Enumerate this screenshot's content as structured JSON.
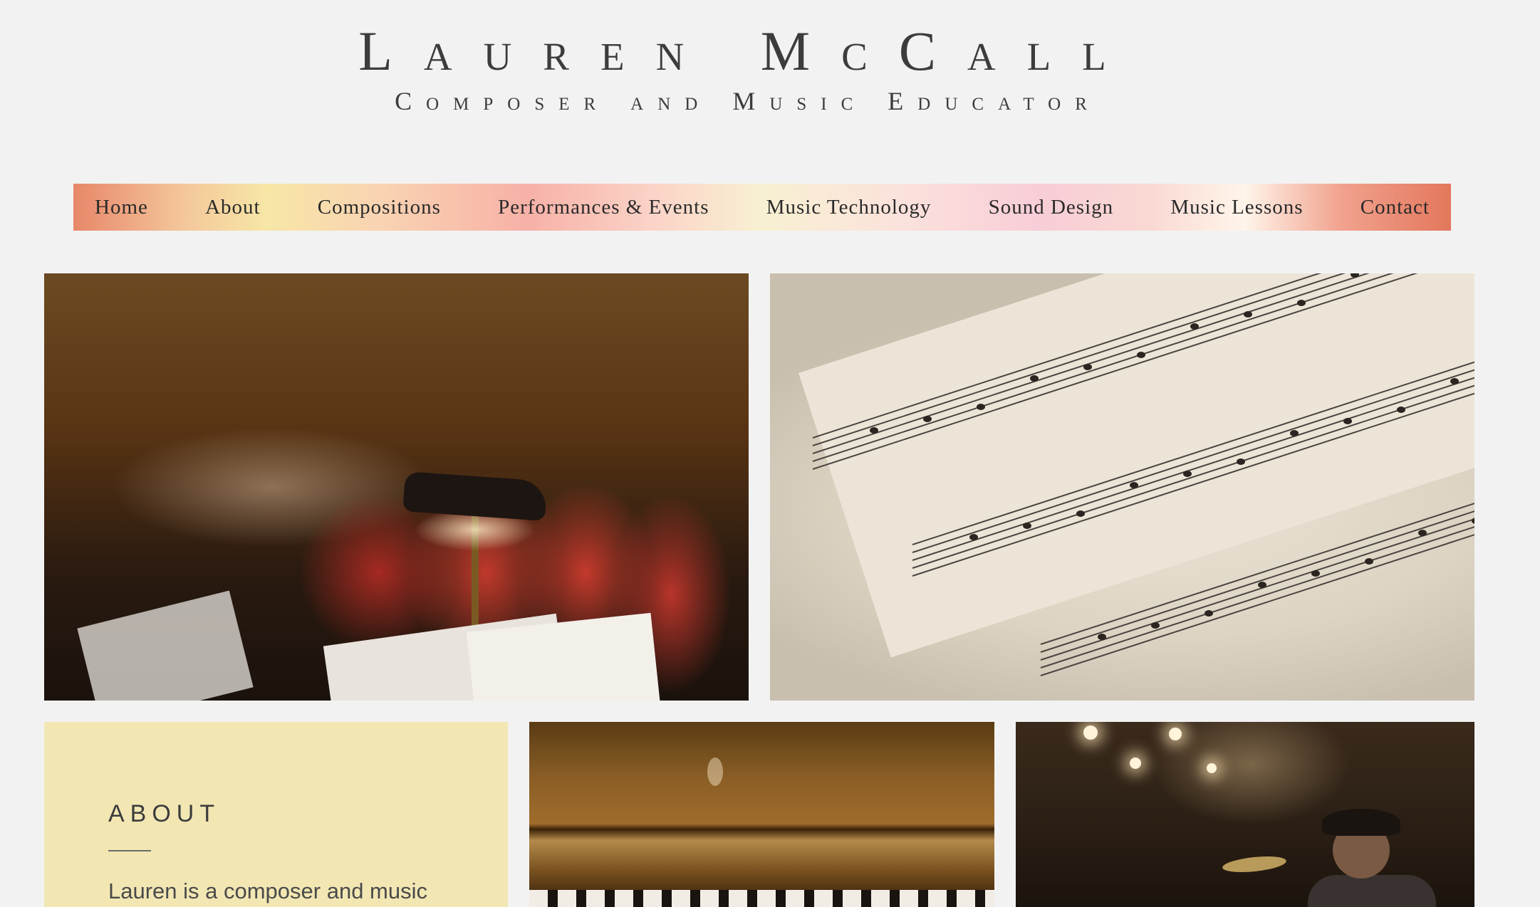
{
  "header": {
    "title": "Lauren McCall",
    "subtitle": "Composer and Music Educator"
  },
  "nav": {
    "items": [
      {
        "label": "Home"
      },
      {
        "label": "About"
      },
      {
        "label": "Compositions"
      },
      {
        "label": "Performances & Events"
      },
      {
        "label": "Music Technology"
      },
      {
        "label": "Sound Design"
      },
      {
        "label": "Music Lessons"
      },
      {
        "label": "Contact"
      }
    ]
  },
  "gallery": {
    "images": [
      {
        "name": "choir-image"
      },
      {
        "name": "sheet-music-image"
      },
      {
        "name": "piano-image"
      },
      {
        "name": "concert-image"
      }
    ]
  },
  "about": {
    "heading": "About",
    "text": "Lauren is a composer and music"
  },
  "colors": {
    "background": "#f2f2f2",
    "about_panel": "#f2e7b3",
    "nav_start": "#e8876a",
    "nav_end": "#e3775c",
    "text": "#3c3c3c"
  }
}
